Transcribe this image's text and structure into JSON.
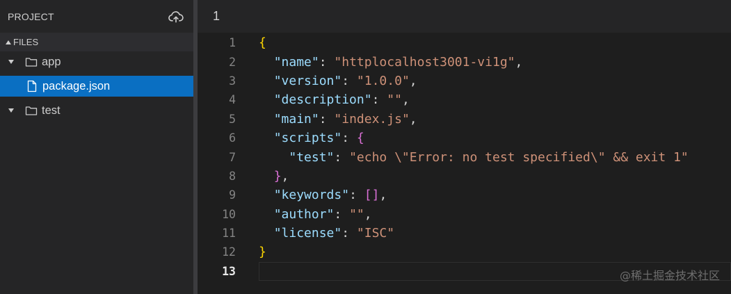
{
  "sidebar": {
    "title": "PROJECT",
    "upload_icon": "cloud-upload-icon",
    "files_label": "FILES",
    "tree": [
      {
        "type": "folder",
        "label": "app"
      },
      {
        "type": "file",
        "label": "package.json",
        "selected": true
      },
      {
        "type": "folder",
        "label": "test"
      }
    ]
  },
  "editor": {
    "tab_label": "1",
    "current_line": 13,
    "lines": [
      {
        "n": "1",
        "tokens": [
          [
            "b1",
            "{"
          ]
        ]
      },
      {
        "n": "2",
        "tokens": [
          [
            "p",
            "  "
          ],
          [
            "k",
            "\"name\""
          ],
          [
            "p",
            ": "
          ],
          [
            "s",
            "\"httplocalhost3001-vi1g\""
          ],
          [
            "p",
            ","
          ]
        ]
      },
      {
        "n": "3",
        "tokens": [
          [
            "p",
            "  "
          ],
          [
            "k",
            "\"version\""
          ],
          [
            "p",
            ": "
          ],
          [
            "s",
            "\"1.0.0\""
          ],
          [
            "p",
            ","
          ]
        ]
      },
      {
        "n": "4",
        "tokens": [
          [
            "p",
            "  "
          ],
          [
            "k",
            "\"description\""
          ],
          [
            "p",
            ": "
          ],
          [
            "s",
            "\"\""
          ],
          [
            "p",
            ","
          ]
        ]
      },
      {
        "n": "5",
        "tokens": [
          [
            "p",
            "  "
          ],
          [
            "k",
            "\"main\""
          ],
          [
            "p",
            ": "
          ],
          [
            "s",
            "\"index.js\""
          ],
          [
            "p",
            ","
          ]
        ]
      },
      {
        "n": "6",
        "tokens": [
          [
            "p",
            "  "
          ],
          [
            "k",
            "\"scripts\""
          ],
          [
            "p",
            ": "
          ],
          [
            "b2",
            "{"
          ]
        ]
      },
      {
        "n": "7",
        "tokens": [
          [
            "p",
            "    "
          ],
          [
            "k",
            "\"test\""
          ],
          [
            "p",
            ": "
          ],
          [
            "s",
            "\"echo \\\"Error: no test specified\\\" && exit 1\""
          ]
        ]
      },
      {
        "n": "8",
        "tokens": [
          [
            "p",
            "  "
          ],
          [
            "b2",
            "}"
          ],
          [
            "p",
            ","
          ]
        ]
      },
      {
        "n": "9",
        "tokens": [
          [
            "p",
            "  "
          ],
          [
            "k",
            "\"keywords\""
          ],
          [
            "p",
            ": "
          ],
          [
            "b2",
            "[]"
          ],
          [
            "p",
            ","
          ]
        ]
      },
      {
        "n": "10",
        "tokens": [
          [
            "p",
            "  "
          ],
          [
            "k",
            "\"author\""
          ],
          [
            "p",
            ": "
          ],
          [
            "s",
            "\"\""
          ],
          [
            "p",
            ","
          ]
        ]
      },
      {
        "n": "11",
        "tokens": [
          [
            "p",
            "  "
          ],
          [
            "k",
            "\"license\""
          ],
          [
            "p",
            ": "
          ],
          [
            "s",
            "\"ISC\""
          ]
        ]
      },
      {
        "n": "12",
        "tokens": [
          [
            "b1",
            "}"
          ]
        ]
      },
      {
        "n": "13",
        "tokens": []
      }
    ]
  },
  "watermark": "@稀土掘金技术社区",
  "colors": {
    "selection": "#0a6fc2",
    "json_key": "#9cdcfe",
    "json_string": "#ce9178",
    "bracket_outer": "#ffd700",
    "bracket_inner": "#da70d6"
  }
}
